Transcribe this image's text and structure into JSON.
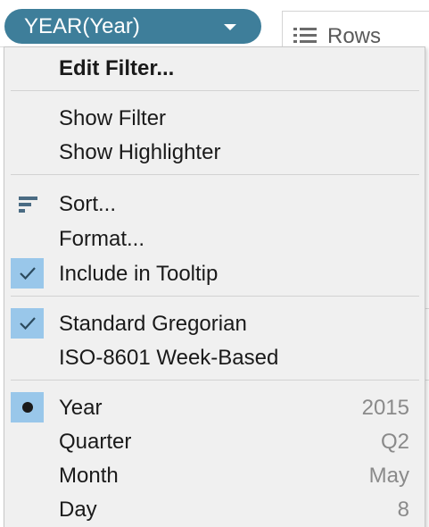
{
  "pill": {
    "label": "YEAR(Year)",
    "color": "#3e7e9a"
  },
  "shelf": {
    "rows_label": "Rows",
    "icon": "list-icon"
  },
  "menu": {
    "edit_filter": "Edit Filter...",
    "show_filter": "Show Filter",
    "show_highlighter": "Show Highlighter",
    "sort": "Sort...",
    "format": "Format...",
    "include_tooltip": "Include in Tooltip",
    "standard_gregorian": "Standard Gregorian",
    "iso_week": "ISO-8601 Week-Based",
    "date_parts": [
      {
        "label": "Year",
        "value": "2015",
        "selected": true
      },
      {
        "label": "Quarter",
        "value": "Q2",
        "selected": false
      },
      {
        "label": "Month",
        "value": "May",
        "selected": false
      },
      {
        "label": "Day",
        "value": "8",
        "selected": false
      }
    ],
    "check_highlight_color": "#99c7ea",
    "icons": {
      "sort": "sort-icon",
      "check": "checkmark-icon",
      "bullet": "bullet-icon"
    }
  }
}
